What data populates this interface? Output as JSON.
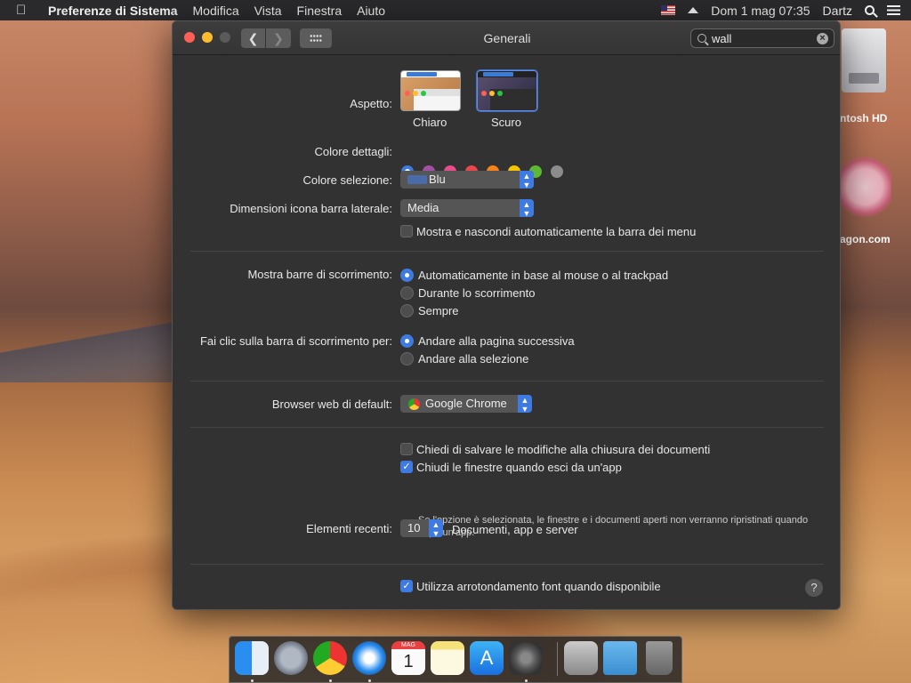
{
  "menubar": {
    "app_name": "Preferenze di Sistema",
    "menus": [
      "Modifica",
      "Vista",
      "Finestra",
      "Aiuto"
    ],
    "clock": "Dom 1 mag  07:35",
    "user": "Dartz"
  },
  "desktop": {
    "hd_label": "ntosh HD",
    "dragon_label": "agon.com"
  },
  "window": {
    "title": "Generali",
    "search_value": "wall"
  },
  "appearance": {
    "label": "Aspetto:",
    "options": [
      {
        "label": "Chiaro",
        "selected": false
      },
      {
        "label": "Scuro",
        "selected": true
      }
    ]
  },
  "accent": {
    "label": "Colore dettagli:",
    "colors": [
      "#3f7ae0",
      "#a550a7",
      "#e84c8b",
      "#e8474c",
      "#f7821b",
      "#f5c400",
      "#5db836",
      "#8c8c8c"
    ],
    "selected_index": 0
  },
  "highlight": {
    "label": "Colore selezione:",
    "value": "Blu",
    "swatch_color": "#4a6aa8"
  },
  "sidebar_icon": {
    "label": "Dimensioni icona barra laterale:",
    "value": "Media"
  },
  "menubar_autohide": {
    "label": "Mostra e nascondi automaticamente la barra dei menu",
    "checked": false
  },
  "scrollbars": {
    "label": "Mostra barre di scorrimento:",
    "options": [
      "Automaticamente in base al mouse o al trackpad",
      "Durante lo scorrimento",
      "Sempre"
    ],
    "selected_index": 0
  },
  "scroll_click": {
    "label": "Fai clic sulla barra di scorrimento per:",
    "options": [
      "Andare alla pagina successiva",
      "Andare alla selezione"
    ],
    "selected_index": 0
  },
  "browser": {
    "label": "Browser web di default:",
    "value": "Google Chrome"
  },
  "documents": {
    "ask_save": {
      "label": "Chiedi di salvare le modifiche alla chiusura dei documenti",
      "checked": false
    },
    "close_windows": {
      "label": "Chiudi le finestre quando esci da un'app",
      "checked": true
    },
    "note": "Se l'opzione è selezionata, le finestre e i documenti aperti non verranno ripristinati quando riapri un'app."
  },
  "recent": {
    "label": "Elementi recenti:",
    "value": "10",
    "suffix": "Documenti, app e server"
  },
  "font_smoothing": {
    "label": "Utilizza arrotondamento font quando disponibile",
    "checked": true
  },
  "help": "?",
  "dock": {
    "calendar_month": "MAG",
    "calendar_day": "1",
    "apps": [
      "finder-icon",
      "launchpad-icon",
      "chrome-icon",
      "safari-icon",
      "calendar-icon",
      "notes-icon",
      "app-store-icon",
      "system-preferences-icon",
      "utility-icon",
      "downloads-folder-icon",
      "trash-icon"
    ]
  }
}
